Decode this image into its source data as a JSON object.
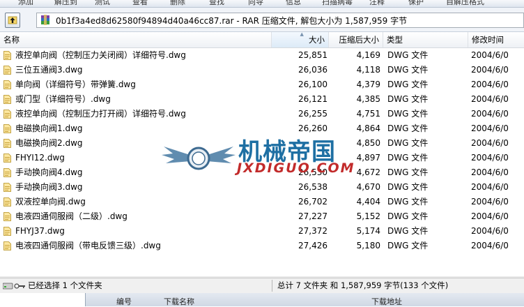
{
  "toolbar": {
    "items": [
      "添加",
      "解压到",
      "测试",
      "查看",
      "删除",
      "查找",
      "向导",
      "信息",
      "扫描病毒",
      "注释",
      "保护",
      "自解压格式"
    ]
  },
  "address": {
    "path": "0b1f3a4ed8d62580f94894d40a46cc87.rar - RAR 压缩文件, 解包大小为 1,587,959 字节"
  },
  "columns": {
    "name": "名称",
    "size": "大小",
    "packed": "压缩后大小",
    "type": "类型",
    "modified": "修改时间"
  },
  "files": [
    {
      "name": "液控单向阀（控制压力关闭阀）详细符号.dwg",
      "size": "25,851",
      "packed": "4,169",
      "type": "DWG 文件",
      "modified": "2004/6/0"
    },
    {
      "name": "三位五通阀3.dwg",
      "size": "26,036",
      "packed": "4,118",
      "type": "DWG 文件",
      "modified": "2004/6/0"
    },
    {
      "name": "单向阀（详细符号）带弹簧.dwg",
      "size": "26,100",
      "packed": "4,379",
      "type": "DWG 文件",
      "modified": "2004/6/0"
    },
    {
      "name": "或门型（详细符号）.dwg",
      "size": "26,121",
      "packed": "4,385",
      "type": "DWG 文件",
      "modified": "2004/6/0"
    },
    {
      "name": "液控单向阀（控制压力打开阀）详细符号.dwg",
      "size": "26,255",
      "packed": "4,751",
      "type": "DWG 文件",
      "modified": "2004/6/0"
    },
    {
      "name": "电磁换向阀1.dwg",
      "size": "26,260",
      "packed": "4,864",
      "type": "DWG 文件",
      "modified": "2004/6/0"
    },
    {
      "name": "电磁换向阀2.dwg",
      "size": "",
      "packed": "4,850",
      "type": "DWG 文件",
      "modified": "2004/6/0"
    },
    {
      "name": "FHYI12.dwg",
      "size": "",
      "packed": "4,897",
      "type": "DWG 文件",
      "modified": "2004/6/0"
    },
    {
      "name": "手动换向阀4.dwg",
      "size": "26,530",
      "packed": "4,672",
      "type": "DWG 文件",
      "modified": "2004/6/0"
    },
    {
      "name": "手动换向阀3.dwg",
      "size": "26,538",
      "packed": "4,670",
      "type": "DWG 文件",
      "modified": "2004/6/0"
    },
    {
      "name": "双液控单向阀.dwg",
      "size": "26,702",
      "packed": "4,404",
      "type": "DWG 文件",
      "modified": "2004/6/0"
    },
    {
      "name": "电液四通伺服阀（二级）.dwg",
      "size": "27,227",
      "packed": "5,152",
      "type": "DWG 文件",
      "modified": "2004/6/0"
    },
    {
      "name": "FHYJ37.dwg",
      "size": "27,372",
      "packed": "5,174",
      "type": "DWG 文件",
      "modified": "2004/6/0"
    },
    {
      "name": "电液四通伺服阀（带电反馈三级）.dwg",
      "size": "27,426",
      "packed": "5,180",
      "type": "DWG 文件",
      "modified": "2004/6/0"
    }
  ],
  "status": {
    "selection": "已经选择 1 个文件夹",
    "total": "总计 7 文件夹 和 1,587,959 字节(133 个文件)"
  },
  "bottom": {
    "col1": "编号",
    "col2": "下载名称",
    "col3": "下载地址"
  },
  "watermark": {
    "cn": "机械帝国",
    "en": "JXDIGUO.COM"
  },
  "colors": {
    "sorted_header": "#dceaf7",
    "watermark_blue": "#1e6fa3",
    "watermark_red": "#c22b2b"
  }
}
